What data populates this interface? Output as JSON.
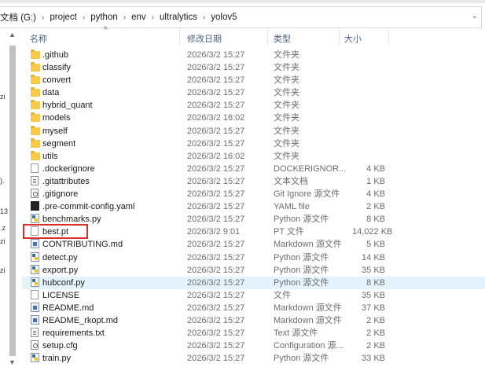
{
  "breadcrumb": [
    "文档 (G:)",
    "project",
    "python",
    "env",
    "ultralytics",
    "yolov5"
  ],
  "columns": {
    "name": "名称",
    "modified": "修改日期",
    "type": "类型",
    "size": "大小"
  },
  "sort_indicator": "^",
  "left_pane_fragments": [
    "zi",
    ").",
    "13",
    ".z",
    "zi",
    "zi"
  ],
  "files": [
    {
      "name": ".github",
      "date": "2026/3/2 15:27",
      "type": "文件夹",
      "size": "",
      "icon": "folder-icon"
    },
    {
      "name": "classify",
      "date": "2026/3/2 15:27",
      "type": "文件夹",
      "size": "",
      "icon": "folder-icon"
    },
    {
      "name": "convert",
      "date": "2026/3/2 15:27",
      "type": "文件夹",
      "size": "",
      "icon": "folder-icon"
    },
    {
      "name": "data",
      "date": "2026/3/2 15:27",
      "type": "文件夹",
      "size": "",
      "icon": "folder-icon"
    },
    {
      "name": "hybrid_quant",
      "date": "2026/3/2 15:27",
      "type": "文件夹",
      "size": "",
      "icon": "folder-icon"
    },
    {
      "name": "models",
      "date": "2026/3/2 16:02",
      "type": "文件夹",
      "size": "",
      "icon": "folder-icon"
    },
    {
      "name": "myself",
      "date": "2026/3/2 15:27",
      "type": "文件夹",
      "size": "",
      "icon": "folder-icon"
    },
    {
      "name": "segment",
      "date": "2026/3/2 15:27",
      "type": "文件夹",
      "size": "",
      "icon": "folder-icon"
    },
    {
      "name": "utils",
      "date": "2026/3/2 16:02",
      "type": "文件夹",
      "size": "",
      "icon": "folder-icon"
    },
    {
      "name": ".dockerignore",
      "date": "2026/3/2 15:27",
      "type": "DOCKERIGNOR...",
      "size": "4 KB",
      "icon": "file-icon"
    },
    {
      "name": ".gitattributes",
      "date": "2026/3/2 15:27",
      "type": "文本文档",
      "size": "1 KB",
      "icon": "text-file-icon"
    },
    {
      "name": ".gitignore",
      "date": "2026/3/2 15:27",
      "type": "Git Ignore 源文件",
      "size": "4 KB",
      "icon": "gear-file-icon"
    },
    {
      "name": ".pre-commit-config.yaml",
      "date": "2026/3/2 15:27",
      "type": "YAML file",
      "size": "2 KB",
      "icon": "yaml-file-icon"
    },
    {
      "name": "benchmarks.py",
      "date": "2026/3/2 15:27",
      "type": "Python 源文件",
      "size": "8 KB",
      "icon": "python-file-icon"
    },
    {
      "name": "best.pt",
      "date": "2026/3/2 9:01",
      "type": "PT 文件",
      "size": "14,022 KB",
      "icon": "file-icon"
    },
    {
      "name": "CONTRIBUTING.md",
      "date": "2026/3/2 15:27",
      "type": "Markdown 源文件",
      "size": "5 KB",
      "icon": "markdown-file-icon"
    },
    {
      "name": "detect.py",
      "date": "2026/3/2 15:27",
      "type": "Python 源文件",
      "size": "14 KB",
      "icon": "python-file-icon"
    },
    {
      "name": "export.py",
      "date": "2026/3/2 15:27",
      "type": "Python 源文件",
      "size": "35 KB",
      "icon": "python-file-icon"
    },
    {
      "name": "hubconf.py",
      "date": "2026/3/2 15:27",
      "type": "Python 源文件",
      "size": "8 KB",
      "icon": "python-file-icon"
    },
    {
      "name": "LICENSE",
      "date": "2026/3/2 15:27",
      "type": "文件",
      "size": "35 KB",
      "icon": "file-icon"
    },
    {
      "name": "README.md",
      "date": "2026/3/2 15:27",
      "type": "Markdown 源文件",
      "size": "37 KB",
      "icon": "markdown-file-icon"
    },
    {
      "name": "README_rkopt.md",
      "date": "2026/3/2 15:27",
      "type": "Markdown 源文件",
      "size": "2 KB",
      "icon": "markdown-file-icon"
    },
    {
      "name": "requirements.txt",
      "date": "2026/3/2 15:27",
      "type": "Text 源文件",
      "size": "2 KB",
      "icon": "text-file-icon"
    },
    {
      "name": "setup.cfg",
      "date": "2026/3/2 15:27",
      "type": "Configuration 源...",
      "size": "2 KB",
      "icon": "gear-file-icon"
    },
    {
      "name": "train.py",
      "date": "2026/3/2 15:27",
      "type": "Python 源文件",
      "size": "33 KB",
      "icon": "python-file-icon"
    }
  ],
  "hover_row": "hubconf.py",
  "highlighted_file": "best.pt",
  "colors": {
    "highlight_border": "#d9302c",
    "hover_row": "#e5f3ff",
    "folder": "#f8c94a",
    "header_text": "#4d6082"
  }
}
